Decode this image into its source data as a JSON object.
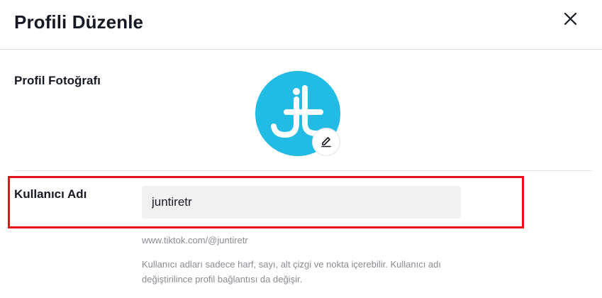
{
  "dialog": {
    "title": "Profili Düzenle",
    "close_icon": "close-icon"
  },
  "profile_photo": {
    "label": "Profil Fotoğrafı",
    "avatar_monogram": "jt",
    "avatar_color": "#21bbe4",
    "edit_icon": "pencil-icon"
  },
  "username": {
    "label": "Kullanıcı Adı",
    "value": "juntiretr",
    "profile_url": "www.tiktok.com/@juntiretr",
    "helper_text": "Kullanıcı adları sadece harf, sayı, alt çizgi ve nokta içerebilir. Kullanıcı adı değiştirilince profil bağlantısı da değişir.",
    "highlight_color": "#e4121d"
  }
}
